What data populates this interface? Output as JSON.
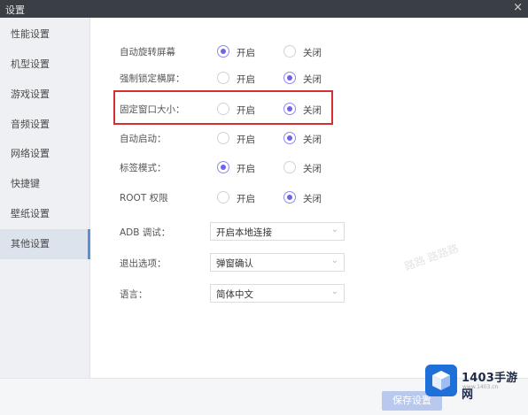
{
  "window": {
    "title": "设置",
    "close_glyph": "×"
  },
  "sidebar": {
    "items": [
      {
        "label": "性能设置",
        "active": false
      },
      {
        "label": "机型设置",
        "active": false
      },
      {
        "label": "游戏设置",
        "active": false
      },
      {
        "label": "音频设置",
        "active": false
      },
      {
        "label": "网络设置",
        "active": false
      },
      {
        "label": "快捷键",
        "active": false
      },
      {
        "label": "壁纸设置",
        "active": false
      },
      {
        "label": "其他设置",
        "active": true
      }
    ]
  },
  "settings": {
    "radio_rows": [
      {
        "label": "自动旋转屏幕",
        "on": "开启",
        "off": "关闭",
        "selected": "on"
      },
      {
        "label": "强制锁定横屏：",
        "on": "开启",
        "off": "关闭",
        "selected": "off"
      },
      {
        "label": "固定窗口大小：",
        "on": "开启",
        "off": "关闭",
        "selected": "off"
      },
      {
        "label": "自动启动：",
        "on": "开启",
        "off": "关闭",
        "selected": "off"
      },
      {
        "label": "标签模式：",
        "on": "开启",
        "off": "关闭",
        "selected": "on"
      },
      {
        "label": "ROOT 权限",
        "on": "开启",
        "off": "关闭",
        "selected": "off"
      }
    ],
    "select_rows": [
      {
        "label": "ADB 调试：",
        "value": "开启本地连接"
      },
      {
        "label": "退出选项：",
        "value": "弹窗确认"
      },
      {
        "label": "语言：",
        "value": "简体中文"
      }
    ],
    "chevron_glyph": "⌄"
  },
  "footer": {
    "save_label": "保存设置"
  },
  "watermark": {
    "brand": "1403手游网",
    "url": "www.1403.cn",
    "faint": "路路 路路路"
  },
  "colors": {
    "accent": "#6f63e6",
    "highlight": "#d43033",
    "brand": "#1f6fd8"
  }
}
